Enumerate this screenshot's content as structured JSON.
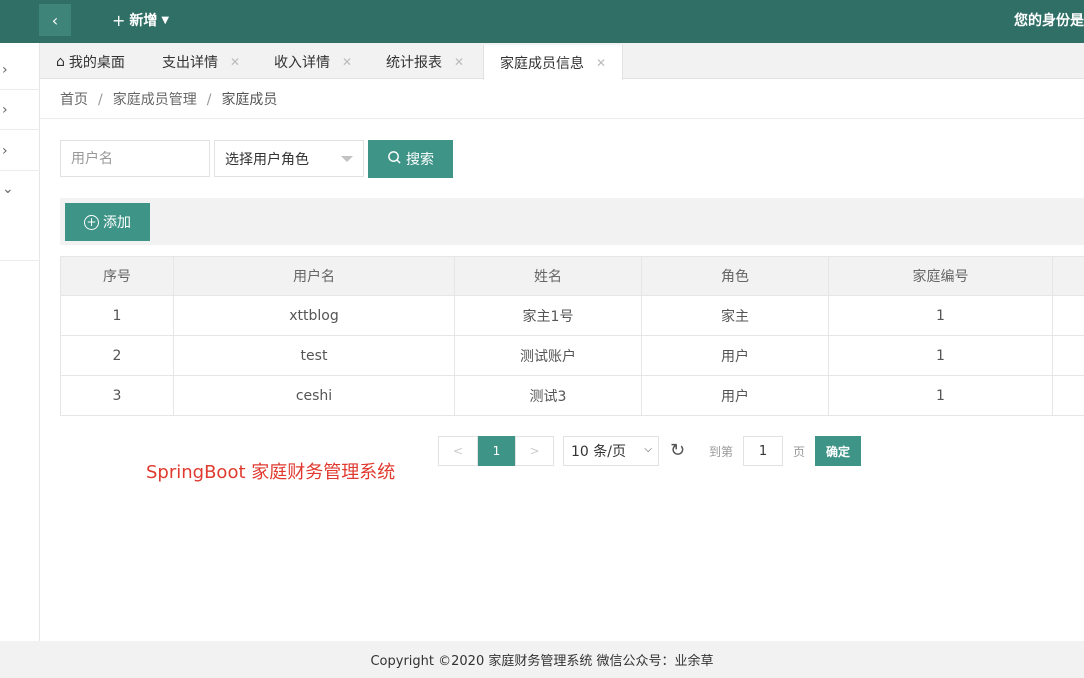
{
  "header": {
    "back_icon": "chevron-left-icon",
    "add_menu_label": "新增",
    "identity_text": "您的身份是"
  },
  "tabs": [
    {
      "label": "我的桌面",
      "icon": "home-icon"
    },
    {
      "label": "支出详情"
    },
    {
      "label": "收入详情"
    },
    {
      "label": "统计报表"
    },
    {
      "label": "家庭成员信息",
      "active": true
    }
  ],
  "breadcrumb": [
    "首页",
    "家庭成员管理",
    "家庭成员"
  ],
  "search": {
    "username_placeholder": "用户名",
    "role_select_value": "选择用户角色",
    "search_label": "搜索"
  },
  "toolbar": {
    "add_label": "添加"
  },
  "table": {
    "headers": [
      "序号",
      "用户名",
      "姓名",
      "角色",
      "家庭编号"
    ],
    "rows": [
      [
        "1",
        "xttblog",
        "家主1号",
        "家主",
        "1"
      ],
      [
        "2",
        "test",
        "测试账户",
        "用户",
        "1"
      ],
      [
        "3",
        "ceshi",
        "测试3",
        "用户",
        "1"
      ]
    ]
  },
  "pagination": {
    "prev": "<",
    "current_page": "1",
    "next": ">",
    "limit_value": "10 条/页",
    "goto_prefix": "到第",
    "goto_value": "1",
    "goto_suffix": "页",
    "confirm_label": "确定"
  },
  "watermark": "SpringBoot 家庭财务管理系统",
  "footer": "Copyright ©2020 家庭财务管理系统 微信公众号：业余草",
  "colors": {
    "header_bg": "#2f6f66",
    "accent": "#3e9487",
    "watermark": "#e03a2f"
  }
}
